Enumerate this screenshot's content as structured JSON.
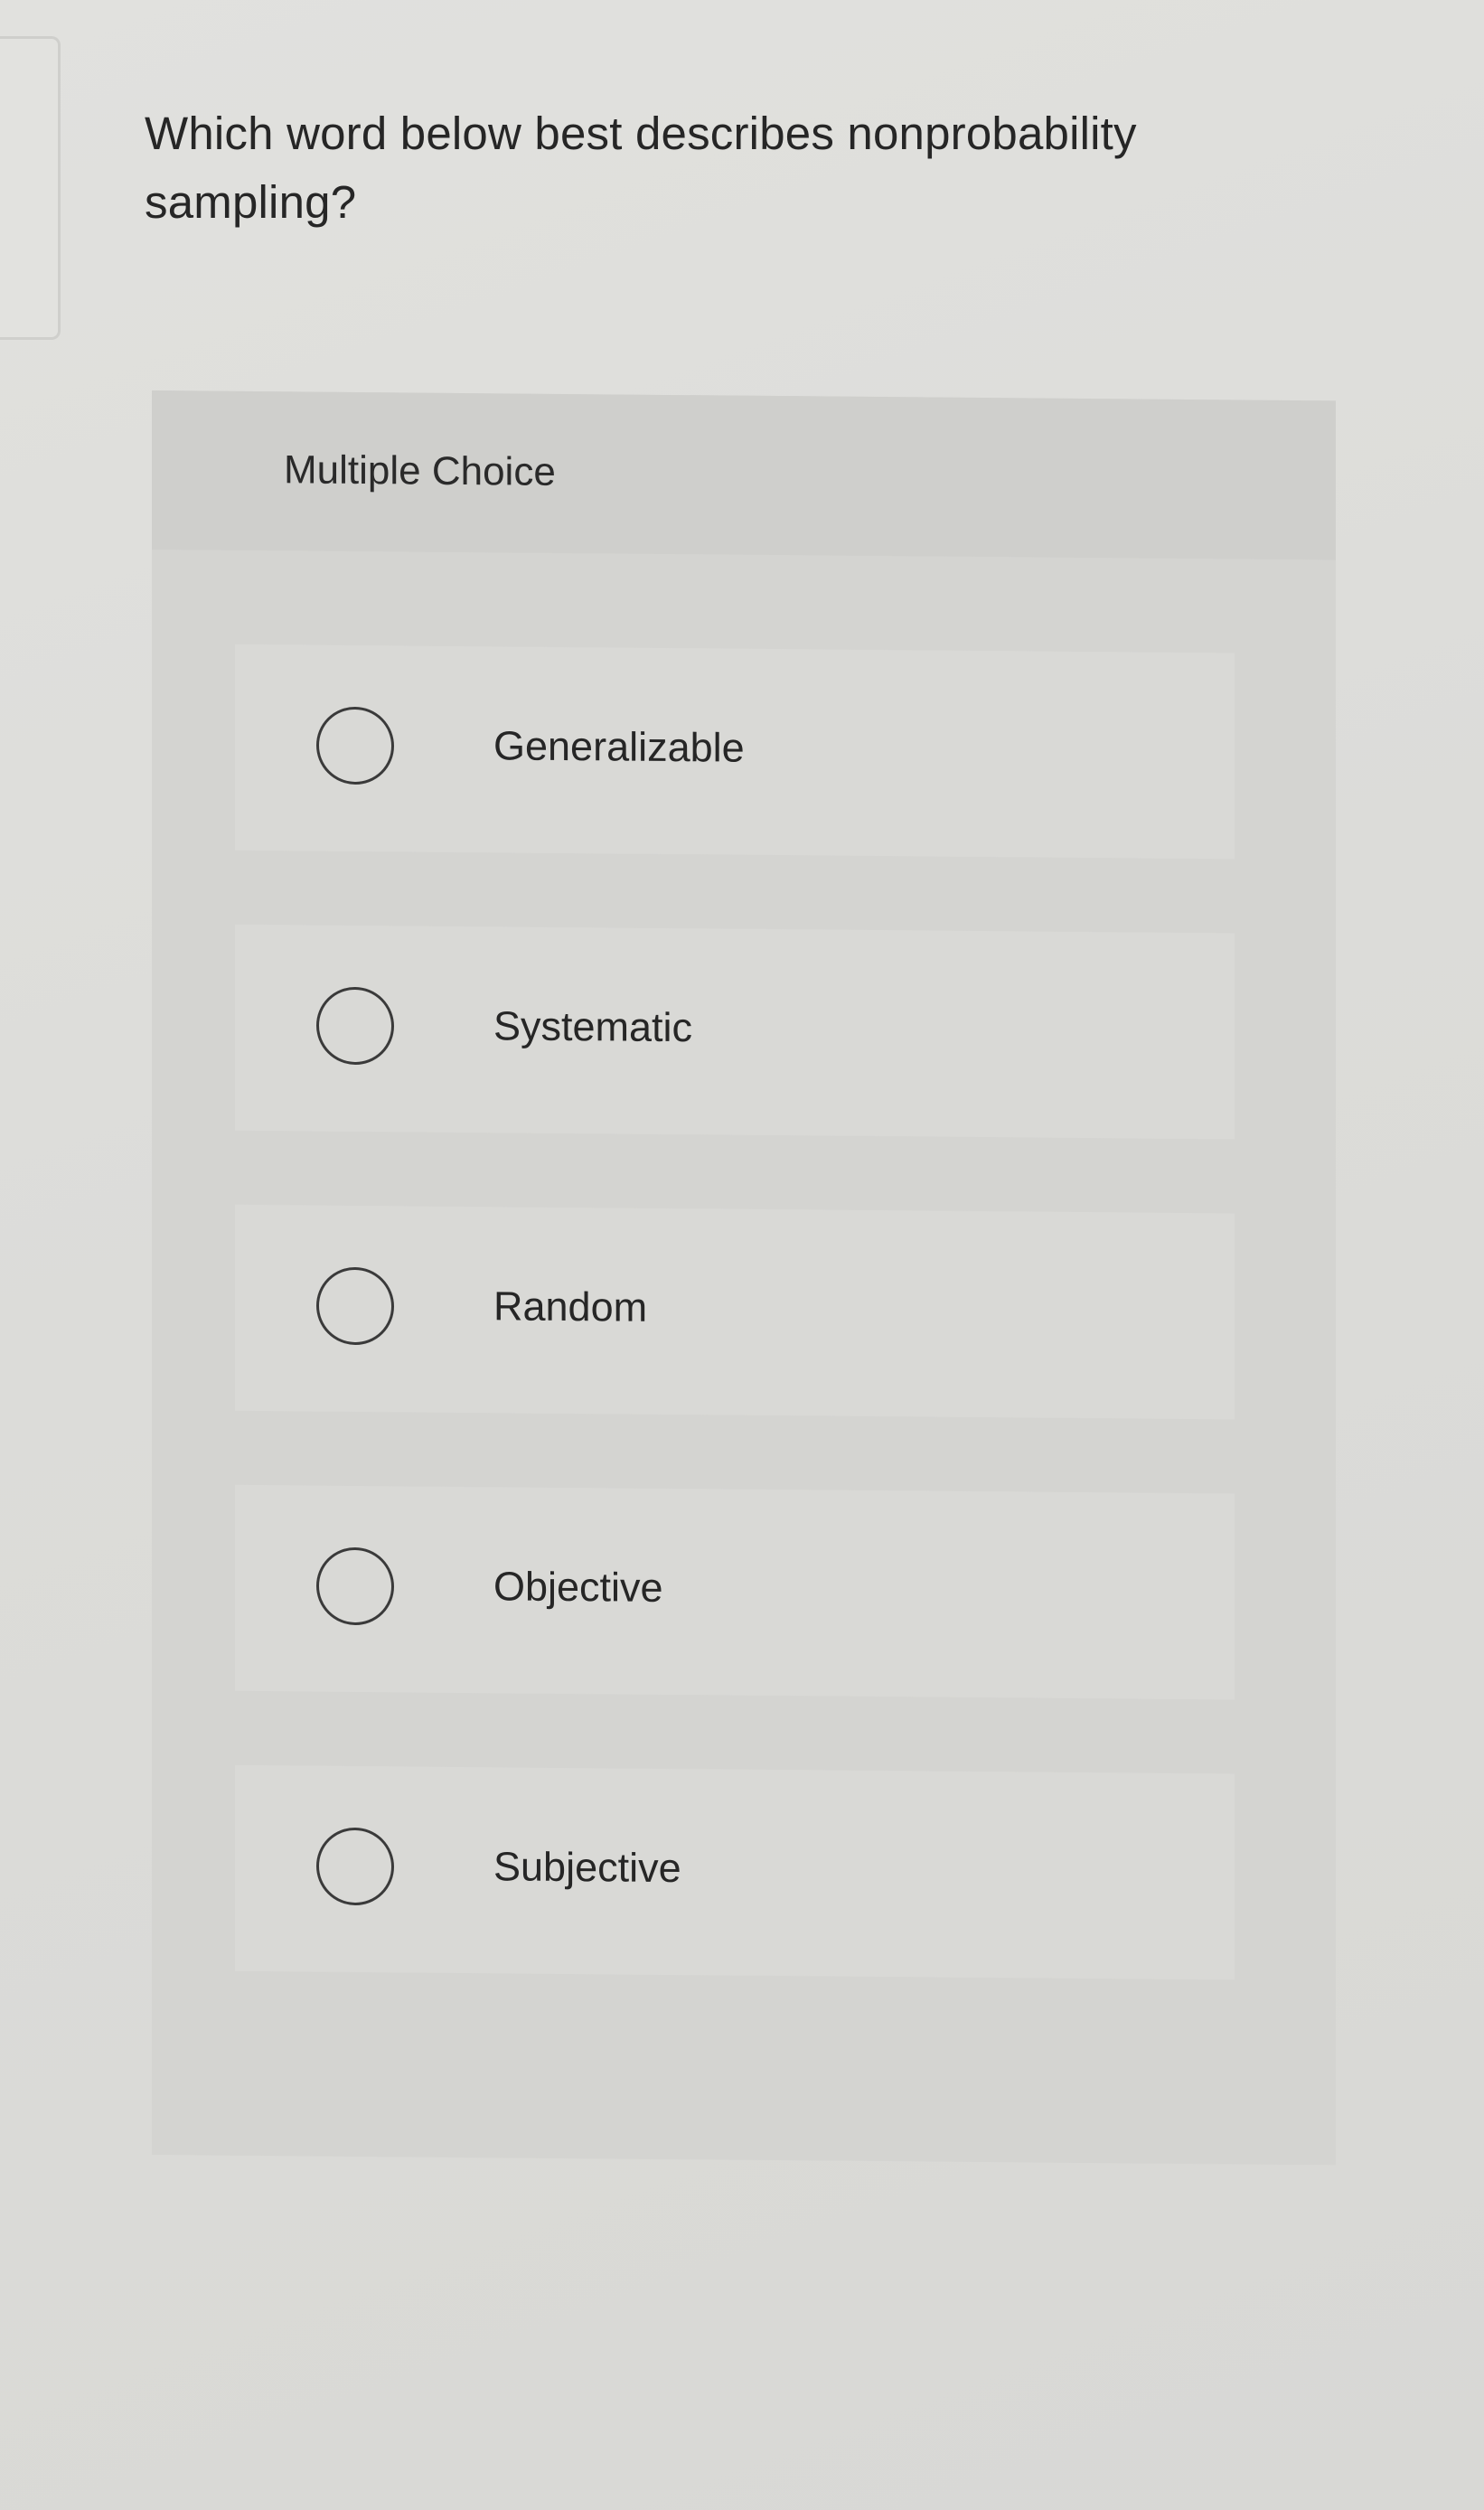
{
  "question": {
    "text": "Which word below best describes nonprobability sampling?"
  },
  "multiple_choice": {
    "header": "Multiple Choice",
    "options": [
      {
        "label": "Generalizable",
        "selected": false
      },
      {
        "label": "Systematic",
        "selected": false
      },
      {
        "label": "Random",
        "selected": false
      },
      {
        "label": "Objective",
        "selected": false
      },
      {
        "label": "Subjective",
        "selected": false
      }
    ]
  },
  "colors": {
    "page_background": "#dededb",
    "panel_background": "#d4d4d1",
    "option_background": "#d9d9d6",
    "text": "#262626"
  }
}
